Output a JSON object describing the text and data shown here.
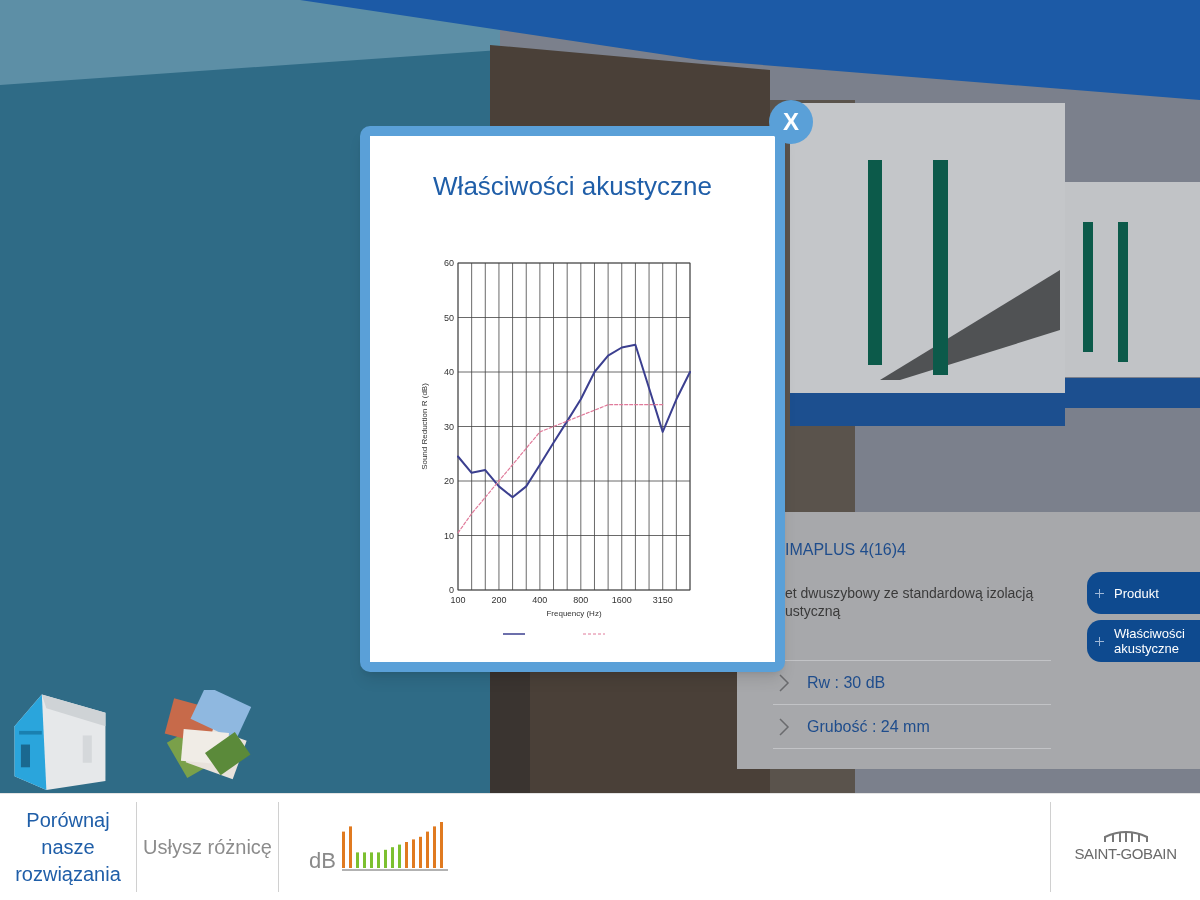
{
  "shortcuts": [
    {
      "kind": "house"
    },
    {
      "kind": "photos"
    }
  ],
  "modal": {
    "close": "X",
    "title": "Właściwości akustyczne",
    "chart_data": {
      "type": "line",
      "xlabel": "Frequency (Hz)",
      "ylabel": "Sound Reduction R (dB)",
      "categories": [
        "100",
        null,
        null,
        "200",
        null,
        null,
        "400",
        null,
        null,
        "800",
        null,
        null,
        "1600",
        null,
        null,
        "3150",
        null,
        null
      ],
      "ylim": [
        0,
        60
      ],
      "yticks": [
        0,
        10,
        20,
        30,
        40,
        50,
        60
      ],
      "grid": true,
      "series": [
        {
          "color": "#3b3f8f",
          "line_style": "solid",
          "values": [
            24.5,
            21.5,
            22,
            19,
            17,
            19,
            23,
            27,
            31,
            35,
            40,
            43,
            44.5,
            45,
            37,
            29,
            35,
            40
          ]
        },
        {
          "color": "#e07a9a",
          "line_style": "dashed",
          "values": [
            10.5,
            14,
            17,
            20,
            23,
            26,
            29,
            30,
            31,
            32,
            33,
            34,
            34,
            34,
            34,
            34,
            null,
            null
          ]
        }
      ]
    }
  },
  "product": {
    "name": "IMAPLUS 4(16)4",
    "description": [
      "et dwuszybowy ze standardową izolacją",
      "ustyczną"
    ],
    "buttons": [
      "Produkt",
      "Właściwości akustyczne"
    ],
    "specs": [
      "Rw : 30 dB",
      "Grubość : 24 mm"
    ]
  },
  "bottom_bar": {
    "items": [
      {
        "kind": "text",
        "label": "Porównaj nasze rozwiązania",
        "selected": true
      },
      {
        "kind": "text",
        "label": "Usłysz różnicę",
        "selected": false
      },
      {
        "kind": "meter",
        "label": "dB"
      }
    ],
    "logo": "SAINT-GOBAIN"
  }
}
